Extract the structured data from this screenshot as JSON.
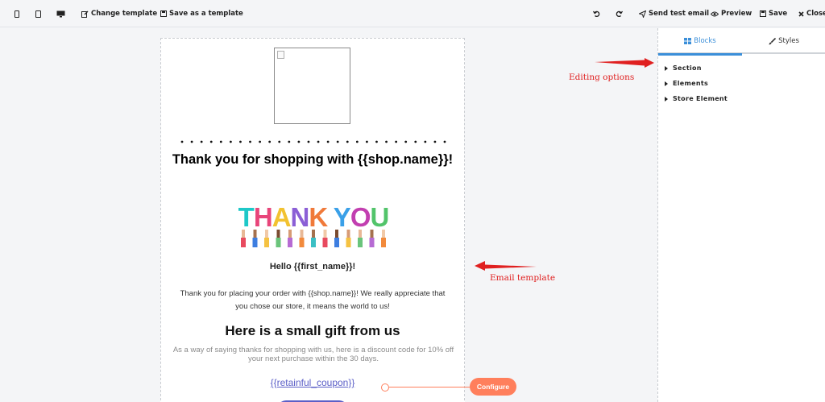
{
  "toolbar": {
    "change_template_label": "Change template",
    "save_as_template_label": "Save as a template",
    "send_test_label": "Send test email",
    "preview_label": "Preview",
    "save_label": "Save",
    "close_label": "Close"
  },
  "email": {
    "heading": "Thank you for shopping with {{shop.name}}!",
    "image_text": "THANK YOU",
    "hello": "Hello {{first_name}}!",
    "paragraph": "Thank you for placing your order with {{shop.name}}! We really appreciate that you chose our store, it means the world to us!",
    "gift_title": "Here is a small gift from us",
    "gift_text": "As a way of saying thanks for shopping with us, here is a discount code for 10% off your next purchase within the 30 days.",
    "coupon": "{{retainful_coupon}}"
  },
  "annotations": {
    "editing_options": "Editing options",
    "email_template": "Email template",
    "configure": "Configure"
  },
  "panel": {
    "tabs": [
      {
        "label": "Blocks",
        "icon": "blocks-icon",
        "active": true
      },
      {
        "label": "Styles",
        "icon": "brush-icon",
        "active": false
      }
    ],
    "items": [
      "Section",
      "Elements",
      "Store Element"
    ]
  },
  "colors": {
    "accent": "#3b8fd9",
    "annotation": "#e02020",
    "configure": "#ff7f5c",
    "link": "#5b5fc7"
  }
}
